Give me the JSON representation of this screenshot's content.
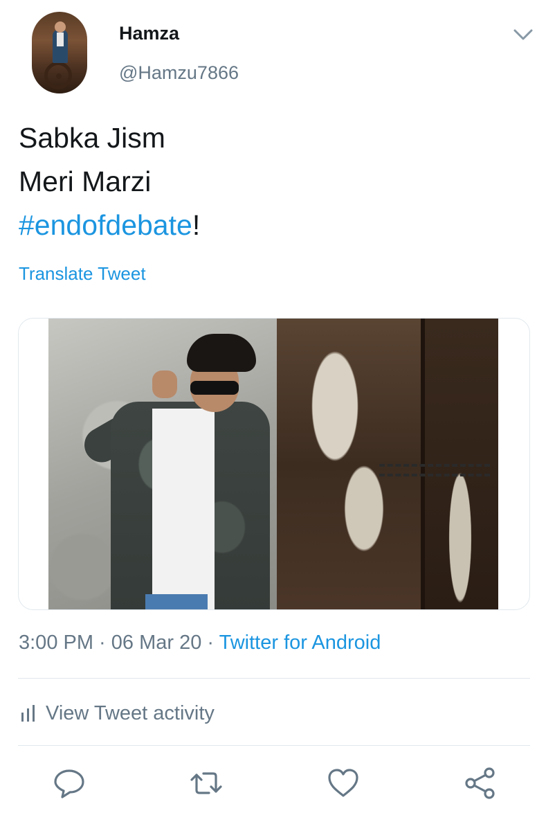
{
  "author": {
    "name": "Hamza",
    "handle": "@Hamzu7866"
  },
  "tweet": {
    "lines": [
      "Sabka Jism",
      "Meri Marzi"
    ],
    "hashtag": "#endofdebate",
    "hashtag_suffix": "!",
    "translate_label": "Translate Tweet"
  },
  "meta": {
    "time": "3:00 PM",
    "separator": " · ",
    "date": "06 Mar 20",
    "source": "Twitter for Android"
  },
  "activity": {
    "label": "View Tweet activity"
  },
  "actions": [
    {
      "name": "reply",
      "icon": "reply-icon"
    },
    {
      "name": "retweet",
      "icon": "retweet-icon"
    },
    {
      "name": "like",
      "icon": "heart-icon"
    },
    {
      "name": "share",
      "icon": "share-icon"
    }
  ],
  "colors": {
    "accent": "#1b95e0",
    "text": "#14171a",
    "secondary": "#657786",
    "divider": "#e1e8ed"
  }
}
